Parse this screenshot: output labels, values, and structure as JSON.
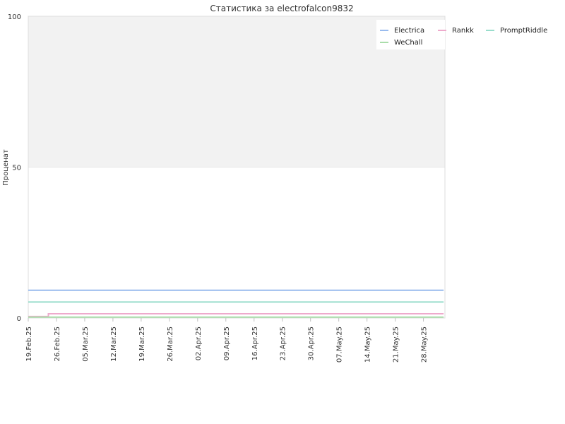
{
  "chart_data": {
    "type": "line",
    "title": "Статистика за electrofalcon9832",
    "xlabel": "",
    "ylabel": "Проценат",
    "ylim": [
      0,
      100
    ],
    "yticks": [
      "0",
      "50",
      "100"
    ],
    "x_range": [
      "2025-02-19",
      "2025-06-02"
    ],
    "x_tick_dates": [
      "2025-02-19",
      "2025-02-26",
      "2025-03-05",
      "2025-03-12",
      "2025-03-19",
      "2025-03-26",
      "2025-04-02",
      "2025-04-09",
      "2025-04-16",
      "2025-04-23",
      "2025-04-30",
      "2025-05-07",
      "2025-05-14",
      "2025-05-21",
      "2025-05-28"
    ],
    "x_tick_labels": [
      "19.Feb.25",
      "26.Feb.25",
      "05.Mar.25",
      "12.Mar.25",
      "19.Mar.25",
      "26.Mar.25",
      "02.Apr.25",
      "09.Apr.25",
      "16.Apr.25",
      "23.Apr.25",
      "30.Apr.25",
      "07.May.25",
      "14.May.25",
      "21.May.25",
      "28.May.25"
    ],
    "grid": true,
    "legend_position": "top-right",
    "band": {
      "from": 50,
      "to": 100,
      "color": "#f2f2f2"
    },
    "series": [
      {
        "name": "Electrica",
        "color": "#99bbee",
        "points": [
          [
            "2025-02-19",
            9.2
          ],
          [
            "2025-06-02",
            9.2
          ]
        ]
      },
      {
        "name": "Rankk",
        "color": "#eeaacc",
        "points": [
          [
            "2025-02-19",
            0.5
          ],
          [
            "2025-02-24",
            0.5
          ],
          [
            "2025-02-24",
            1.4
          ],
          [
            "2025-06-02",
            1.4
          ]
        ]
      },
      {
        "name": "PromptRiddle",
        "color": "#99ddcc",
        "points": [
          [
            "2025-02-19",
            5.3
          ],
          [
            "2025-06-02",
            5.3
          ]
        ]
      },
      {
        "name": "WeChall",
        "color": "#aaddaa",
        "points": [
          [
            "2025-02-19",
            0.3
          ],
          [
            "2025-06-02",
            0.3
          ]
        ]
      }
    ]
  }
}
